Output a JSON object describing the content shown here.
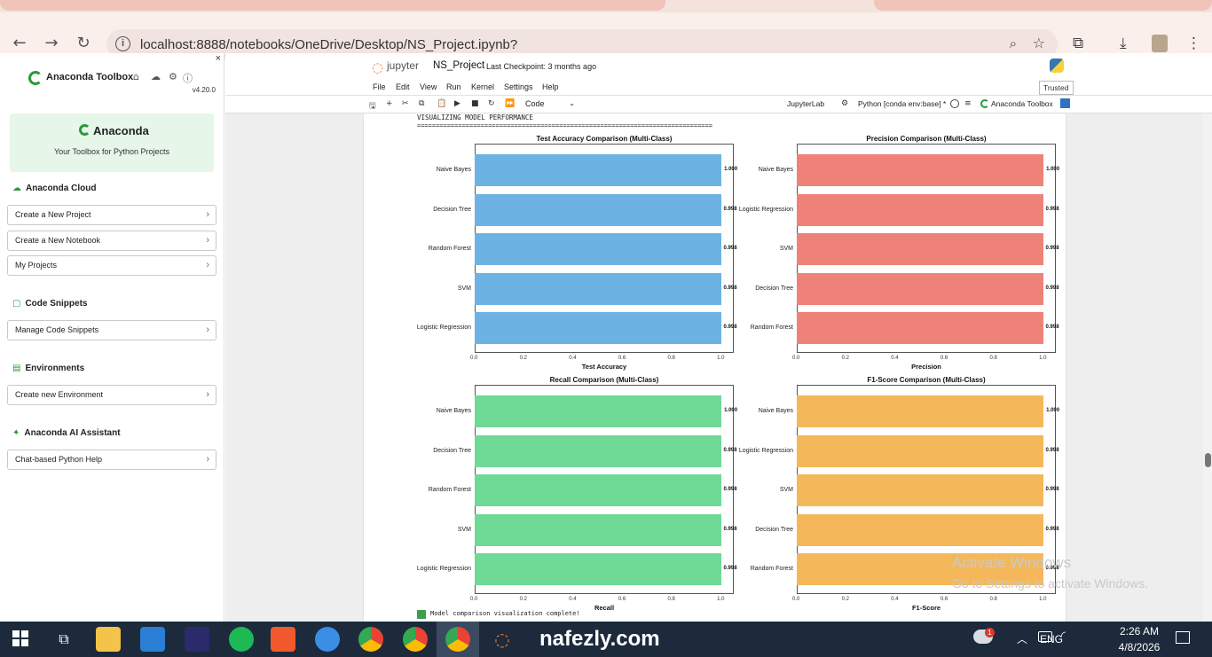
{
  "browser": {
    "url": "localhost:8888/notebooks/OneDrive/Desktop/NS_Project.ipynb?"
  },
  "sidebar": {
    "title": "Anaconda Toolbox",
    "version": "v4.20.0",
    "brand": "Anaconda",
    "tagline": "Your Toolbox for Python Projects",
    "sections": [
      {
        "heading": "Anaconda Cloud",
        "items": [
          "Create a New Project",
          "Create a New Notebook",
          "My Projects"
        ]
      },
      {
        "heading": "Code Snippets",
        "items": [
          "Manage Code Snippets"
        ]
      },
      {
        "heading": "Environments",
        "items": [
          "Create new Environment"
        ]
      },
      {
        "heading": "Anaconda AI Assistant",
        "items": [
          "Chat-based Python Help"
        ]
      }
    ]
  },
  "jupyter": {
    "logo_text": "jupyter",
    "notebook_name": "NS_Project",
    "checkpoint": "Last Checkpoint: 3 months ago",
    "menu": [
      "File",
      "Edit",
      "View",
      "Run",
      "Kernel",
      "Settings",
      "Help"
    ],
    "trusted": "Trusted",
    "cell_type": "Code",
    "jupyterlab": "JupyterLab",
    "kernel": "Python [conda env:base] *",
    "toolbox": "Anaconda Toolbox"
  },
  "output": {
    "header": "VISUALIZING MODEL PERFORMANCE",
    "divider": "================================================================================",
    "footer": "Model comparison visualization complete!"
  },
  "colors": {
    "accuracy": "#6cb3e4",
    "precision": "#ee8279",
    "recall": "#6fd996",
    "f1": "#f4b85a"
  },
  "chart_data": [
    {
      "type": "bar",
      "title": "Test Accuracy Comparison (Multi-Class)",
      "xlabel": "Test Accuracy",
      "categories": [
        "Naive Bayes",
        "Decision Tree",
        "Random Forest",
        "SVM",
        "Logistic Regression"
      ],
      "values": [
        1.0,
        0.998,
        0.998,
        0.998,
        0.998
      ],
      "labels": [
        "1.000",
        "0.998",
        "0.998",
        "0.998",
        "0.998"
      ],
      "xlim": [
        0,
        1.05
      ],
      "ticks": [
        "0.0",
        "0.2",
        "0.4",
        "0.6",
        "0.8",
        "1.0"
      ]
    },
    {
      "type": "bar",
      "title": "Precision Comparison (Multi-Class)",
      "xlabel": "Precision",
      "categories": [
        "Naive Bayes",
        "Logistic Regression",
        "SVM",
        "Decision Tree",
        "Random Forest"
      ],
      "values": [
        1.0,
        0.998,
        0.998,
        0.998,
        0.998
      ],
      "labels": [
        "1.000",
        "0.998",
        "0.998",
        "0.998",
        "0.998"
      ],
      "xlim": [
        0,
        1.05
      ],
      "ticks": [
        "0.0",
        "0.2",
        "0.4",
        "0.6",
        "0.8",
        "1.0"
      ]
    },
    {
      "type": "bar",
      "title": "Recall Comparison (Multi-Class)",
      "xlabel": "Recall",
      "categories": [
        "Naive Bayes",
        "Decision Tree",
        "Random Forest",
        "SVM",
        "Logistic Regression"
      ],
      "values": [
        1.0,
        0.998,
        0.998,
        0.998,
        0.998
      ],
      "labels": [
        "1.000",
        "0.998",
        "0.998",
        "0.998",
        "0.998"
      ],
      "xlim": [
        0,
        1.05
      ],
      "ticks": [
        "0.0",
        "0.2",
        "0.4",
        "0.6",
        "0.8",
        "1.0"
      ]
    },
    {
      "type": "bar",
      "title": "F1-Score Comparison (Multi-Class)",
      "xlabel": "F1-Score",
      "categories": [
        "Naive Bayes",
        "Logistic Regression",
        "SVM",
        "Decision Tree",
        "Random Forest"
      ],
      "values": [
        1.0,
        0.998,
        0.998,
        0.998,
        0.998
      ],
      "labels": [
        "1.000",
        "0.998",
        "0.998",
        "0.998",
        "0.998"
      ],
      "xlim": [
        0,
        1.05
      ],
      "ticks": [
        "0.0",
        "0.2",
        "0.4",
        "0.6",
        "0.8",
        "1.0"
      ]
    }
  ],
  "watermark": {
    "activate_title": "Activate Windows",
    "activate_sub": "Go to Settings to activate Windows.",
    "site": "nafezly.com"
  },
  "taskbar": {
    "lang": "ENG",
    "time": "2:26 AM",
    "date": "4/8/2026",
    "notify_count": "1"
  }
}
